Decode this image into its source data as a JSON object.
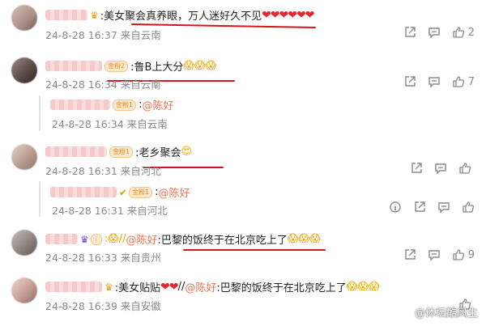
{
  "comments": [
    {
      "text": ":美女聚会真养眼，万人迷好久不见",
      "hearts": "❤❤❤❤❤❤",
      "time": "24-8-28 16:37",
      "location": "来自云南",
      "likes": "2"
    },
    {
      "badge": "金粉2",
      "text": ":鲁B上大分",
      "emojis": "😱😱😱",
      "time": "24-8-28 16:34",
      "location": "来自云南",
      "likes": "7",
      "reply": {
        "badge": "金粉1",
        "mention": "@陈好",
        "time": "24-8-28 16:34",
        "location": "来自云南"
      }
    },
    {
      "badge": "金粉1",
      "text": ":老乡聚会",
      "emojis": "😍",
      "time": "24-8-28 16:31",
      "location": "来自河北",
      "likes": "",
      "reply": {
        "badge": "金粉1",
        "mention": "@陈好",
        "time": "24-8-28 16:31",
        "location": "来自河北"
      }
    },
    {
      "prefix": ":😱//",
      "mention": "@陈好",
      "text": ":巴黎的饭终于在北京吃上了",
      "emojis": "😱😱😱",
      "time": "24-8-28 16:33",
      "location": "来自贵州",
      "likes": "9"
    },
    {
      "text": ":美女贴贴",
      "hearts": "❤❤",
      "mid": "//",
      "mention": "@陈好",
      "tail": ":巴黎的饭终于在北京吃上了",
      "emojis": "😱😱😱",
      "time": "24-8-28 16:39",
      "location": "来自安徽",
      "likes": ""
    }
  ],
  "watermark": "@体坛酷风生"
}
